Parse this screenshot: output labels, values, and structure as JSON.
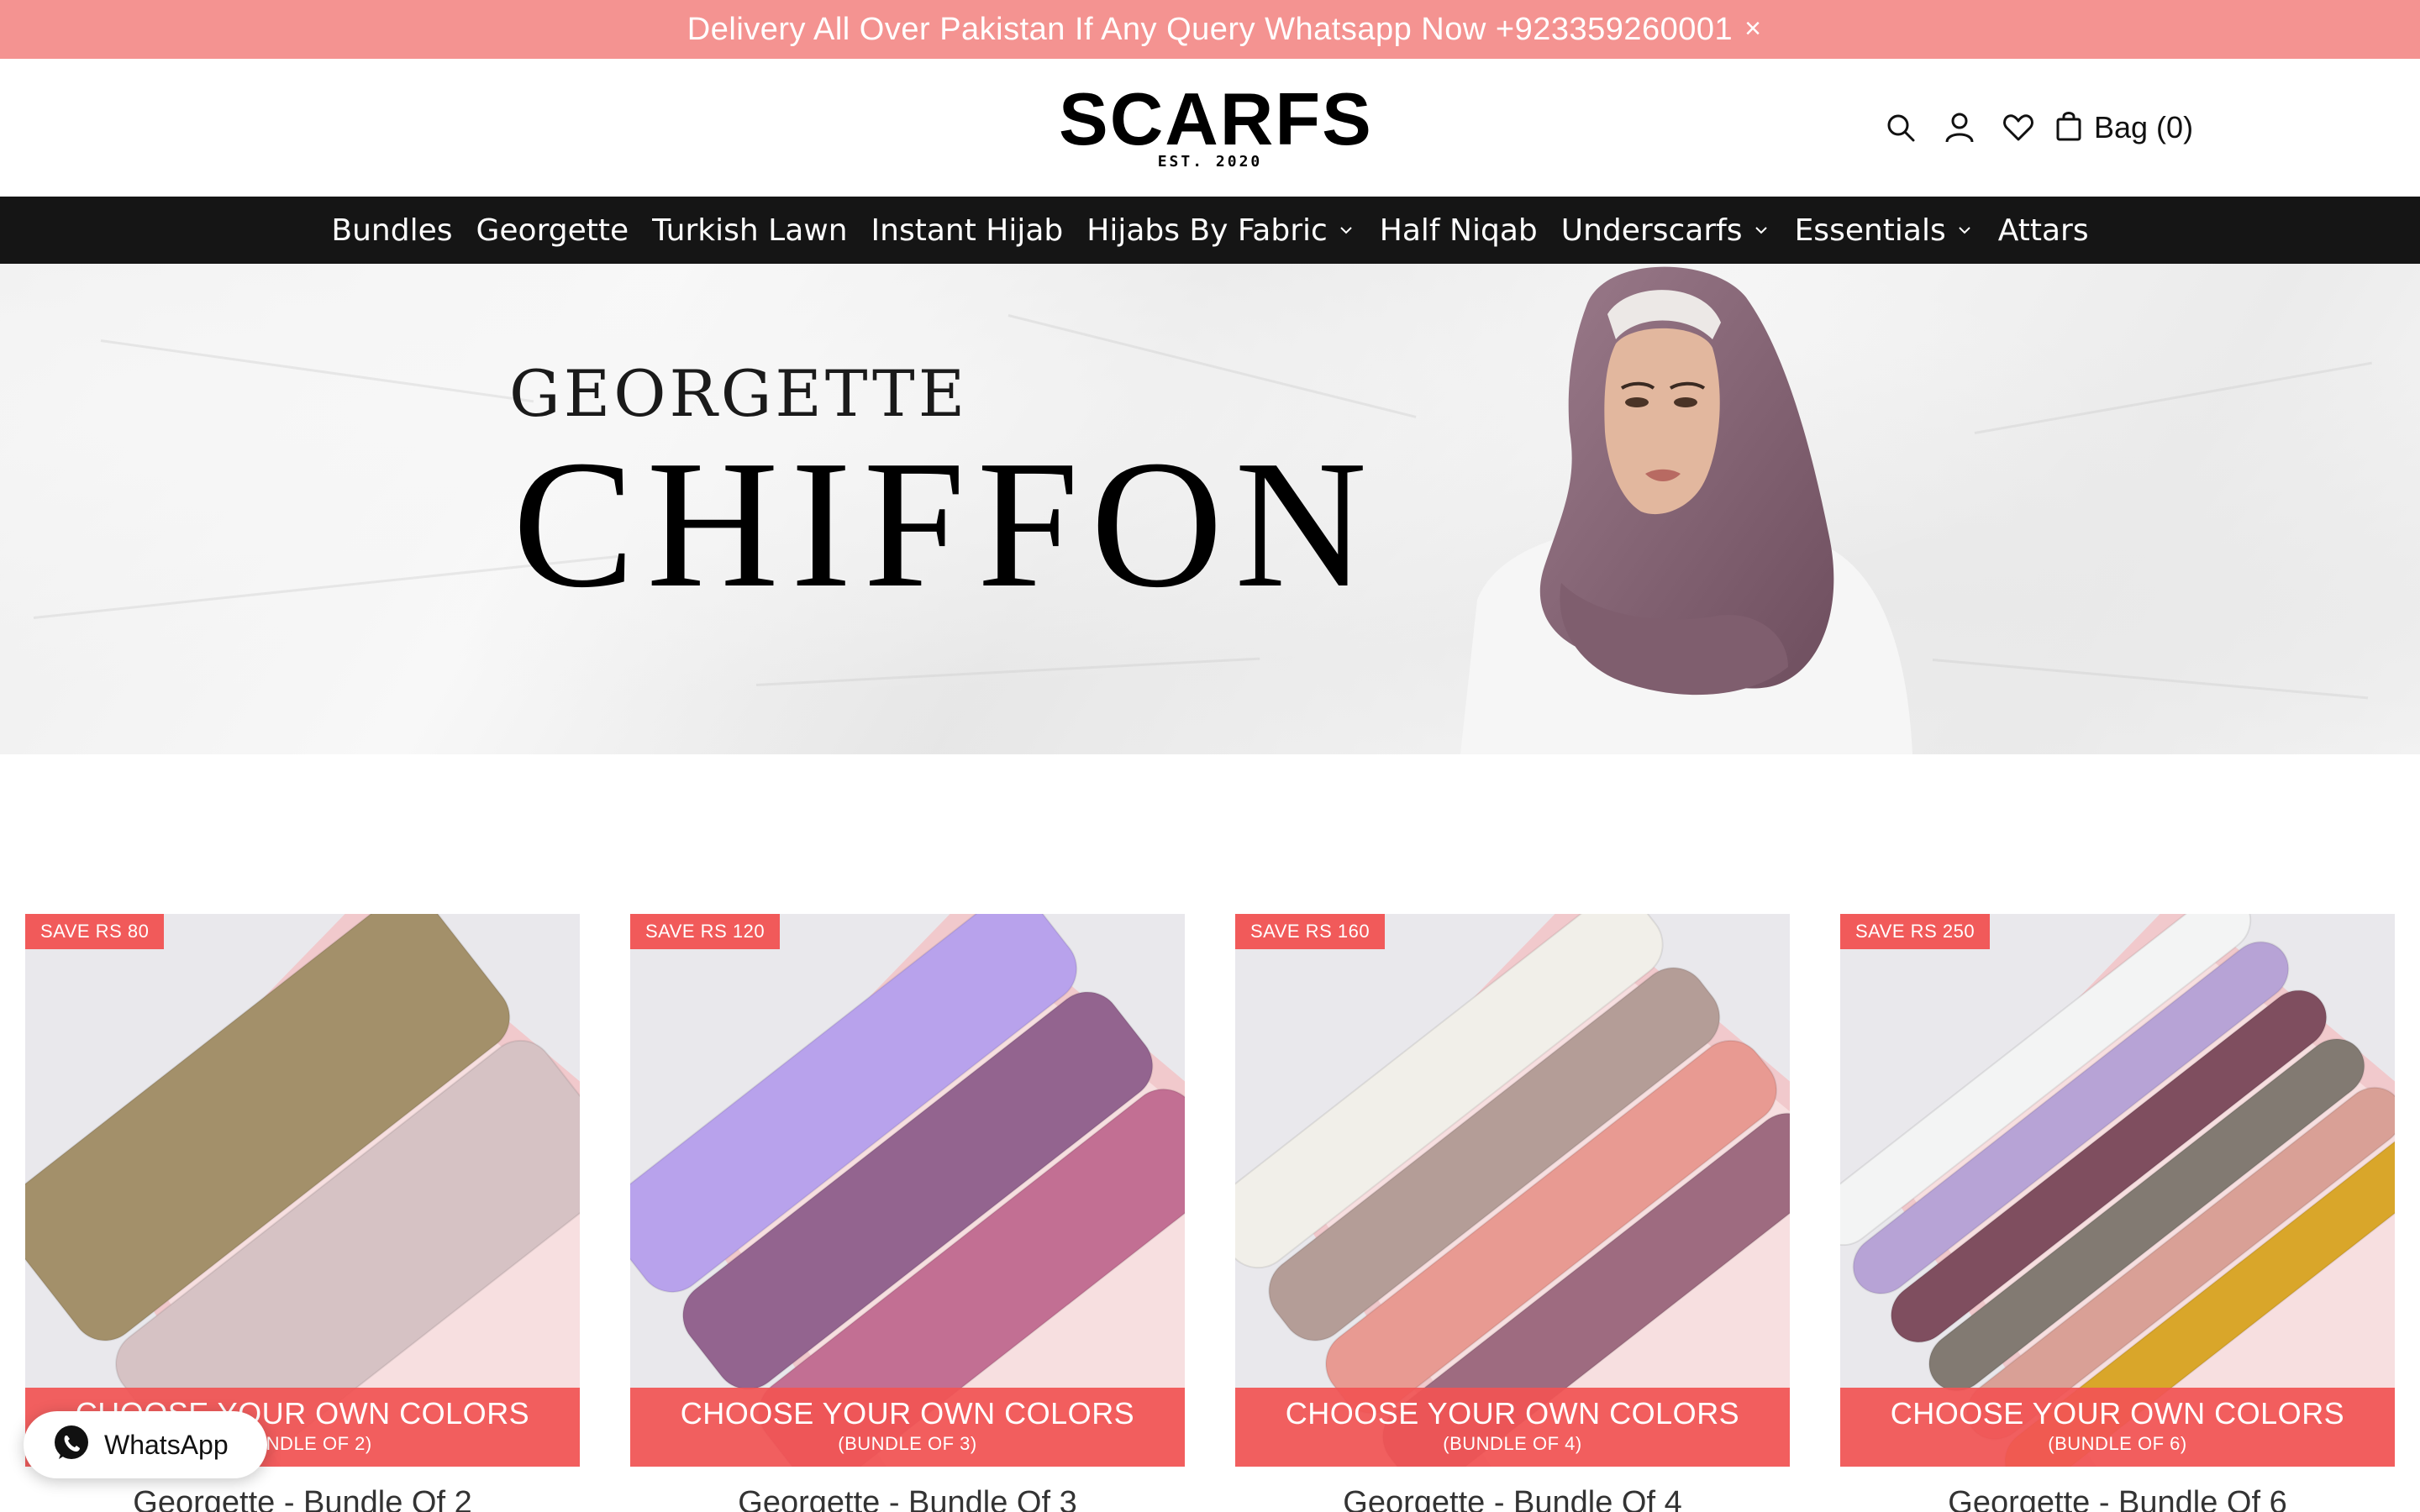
{
  "announcement": {
    "text": "Delivery All Over Pakistan If Any Query Whatsapp Now +923359260001",
    "close": "×"
  },
  "header": {
    "logo_word": "SCARFS",
    "logo_est": "EST. 2020",
    "bag_label": "Bag (0)"
  },
  "nav": [
    {
      "label": "Bundles",
      "dropdown": false
    },
    {
      "label": "Georgette",
      "dropdown": false
    },
    {
      "label": "Turkish Lawn",
      "dropdown": false
    },
    {
      "label": "Instant Hijab",
      "dropdown": false
    },
    {
      "label": "Hijabs By Fabric",
      "dropdown": true
    },
    {
      "label": "Half Niqab",
      "dropdown": false
    },
    {
      "label": "Underscarfs",
      "dropdown": true
    },
    {
      "label": "Essentials",
      "dropdown": true
    },
    {
      "label": "Attars",
      "dropdown": false
    }
  ],
  "hero": {
    "line1": "GEORGETTE",
    "line2": "CHIFFON"
  },
  "products": [
    {
      "badge": "SAVE RS 80",
      "banner_main": "CHOOSE YOUR OWN COLORS",
      "banner_sub": "(BUNDLE OF 2)",
      "title": "Georgette - Bundle Of 2",
      "scarf_colors": [
        "#a3906a",
        "#d6c2c4"
      ]
    },
    {
      "badge": "SAVE RS 120",
      "banner_main": "CHOOSE YOUR OWN COLORS",
      "banner_sub": "(BUNDLE OF 3)",
      "title": "Georgette - Bundle Of 3",
      "scarf_colors": [
        "#b8a2ec",
        "#93648f",
        "#c26f93"
      ]
    },
    {
      "badge": "SAVE RS 160",
      "banner_main": "CHOOSE YOUR OWN COLORS",
      "banner_sub": "(BUNDLE OF 4)",
      "title": "Georgette - Bundle Of 4",
      "scarf_colors": [
        "#f1efe9",
        "#b49d97",
        "#e89a92",
        "#9e6b80"
      ]
    },
    {
      "badge": "SAVE RS 250",
      "banner_main": "CHOOSE YOUR OWN COLORS",
      "banner_sub": "(BUNDLE OF 6)",
      "title": "Georgette - Bundle Of 6",
      "scarf_colors": [
        "#f3f4f4",
        "#b7a3d6",
        "#7f4e5f",
        "#827a72",
        "#d9a096",
        "#d9a62a"
      ]
    }
  ],
  "whatsapp": {
    "label": "WhatsApp"
  },
  "colors": {
    "announcement_bg": "#f49391",
    "nav_bg": "#151515",
    "accent": "#f15a5a"
  }
}
